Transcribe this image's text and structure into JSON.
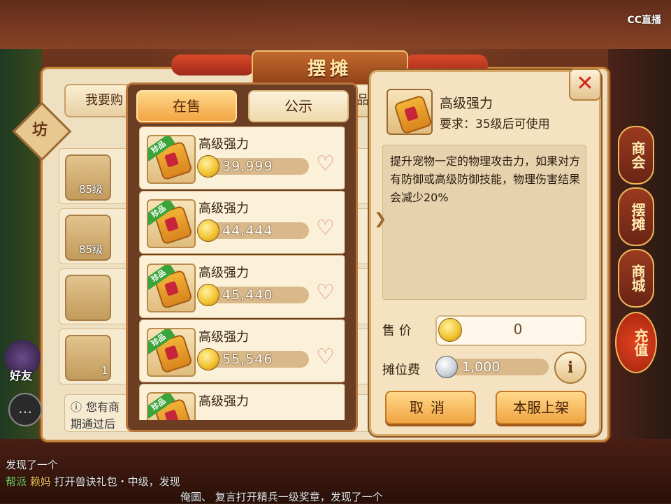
{
  "overlay": {
    "cc_logo": "CC直播"
  },
  "window": {
    "title": "摆摊"
  },
  "back_panel": {
    "tab_buy": "我要购",
    "tab_right_fragment": "品",
    "side_badge": "坊",
    "rows": [
      {
        "level": "85级"
      },
      {
        "level": "85级"
      },
      {
        "level": ""
      },
      {
        "level": "1"
      }
    ],
    "notice_line1": "您有商",
    "notice_line2": "期通过后"
  },
  "side_menu": [
    "商会",
    "摆摊",
    "商城",
    "充值"
  ],
  "left_ui": {
    "friend_label": "好友",
    "chat_icon": "chat-icon"
  },
  "chat": [
    {
      "text": "发现了一个",
      "highlight": ""
    },
    {
      "prefix": "帮派",
      "name": "赖妈",
      "text": "打开兽诀礼包・中级，发现"
    },
    {
      "text": "俺圖、 复言打开精兵一级奖章，发现了一个"
    }
  ],
  "listing": {
    "tabs": {
      "active": "在售",
      "inactive": "公示"
    },
    "rare_tag": "珍品",
    "items": [
      {
        "name": "高级强力",
        "price": "39,999"
      },
      {
        "name": "高级强力",
        "price": "44,444"
      },
      {
        "name": "高级强力",
        "price": "45,440"
      },
      {
        "name": "高级强力",
        "price": "55,546"
      },
      {
        "name": "高级强力",
        "price": ""
      }
    ]
  },
  "detail": {
    "name": "高级强力",
    "requirement": "要求：35级后可使用",
    "description": "提升宠物一定的物理攻击力，如果对方有防御或高级防御技能，物理伤害结果会减少20%",
    "sell_price_label": "售  价",
    "sell_price_value": "0",
    "booth_fee_label": "摊位费",
    "booth_fee_value": "1,000",
    "info_button": "i",
    "cancel_button": "取消",
    "list_button": "本服上架",
    "close_button": "✕"
  },
  "colors": {
    "accent": "#f2a543",
    "panel": "#f4e2c0",
    "rare_green": "#3aa43a",
    "close_red": "#d0261a"
  }
}
